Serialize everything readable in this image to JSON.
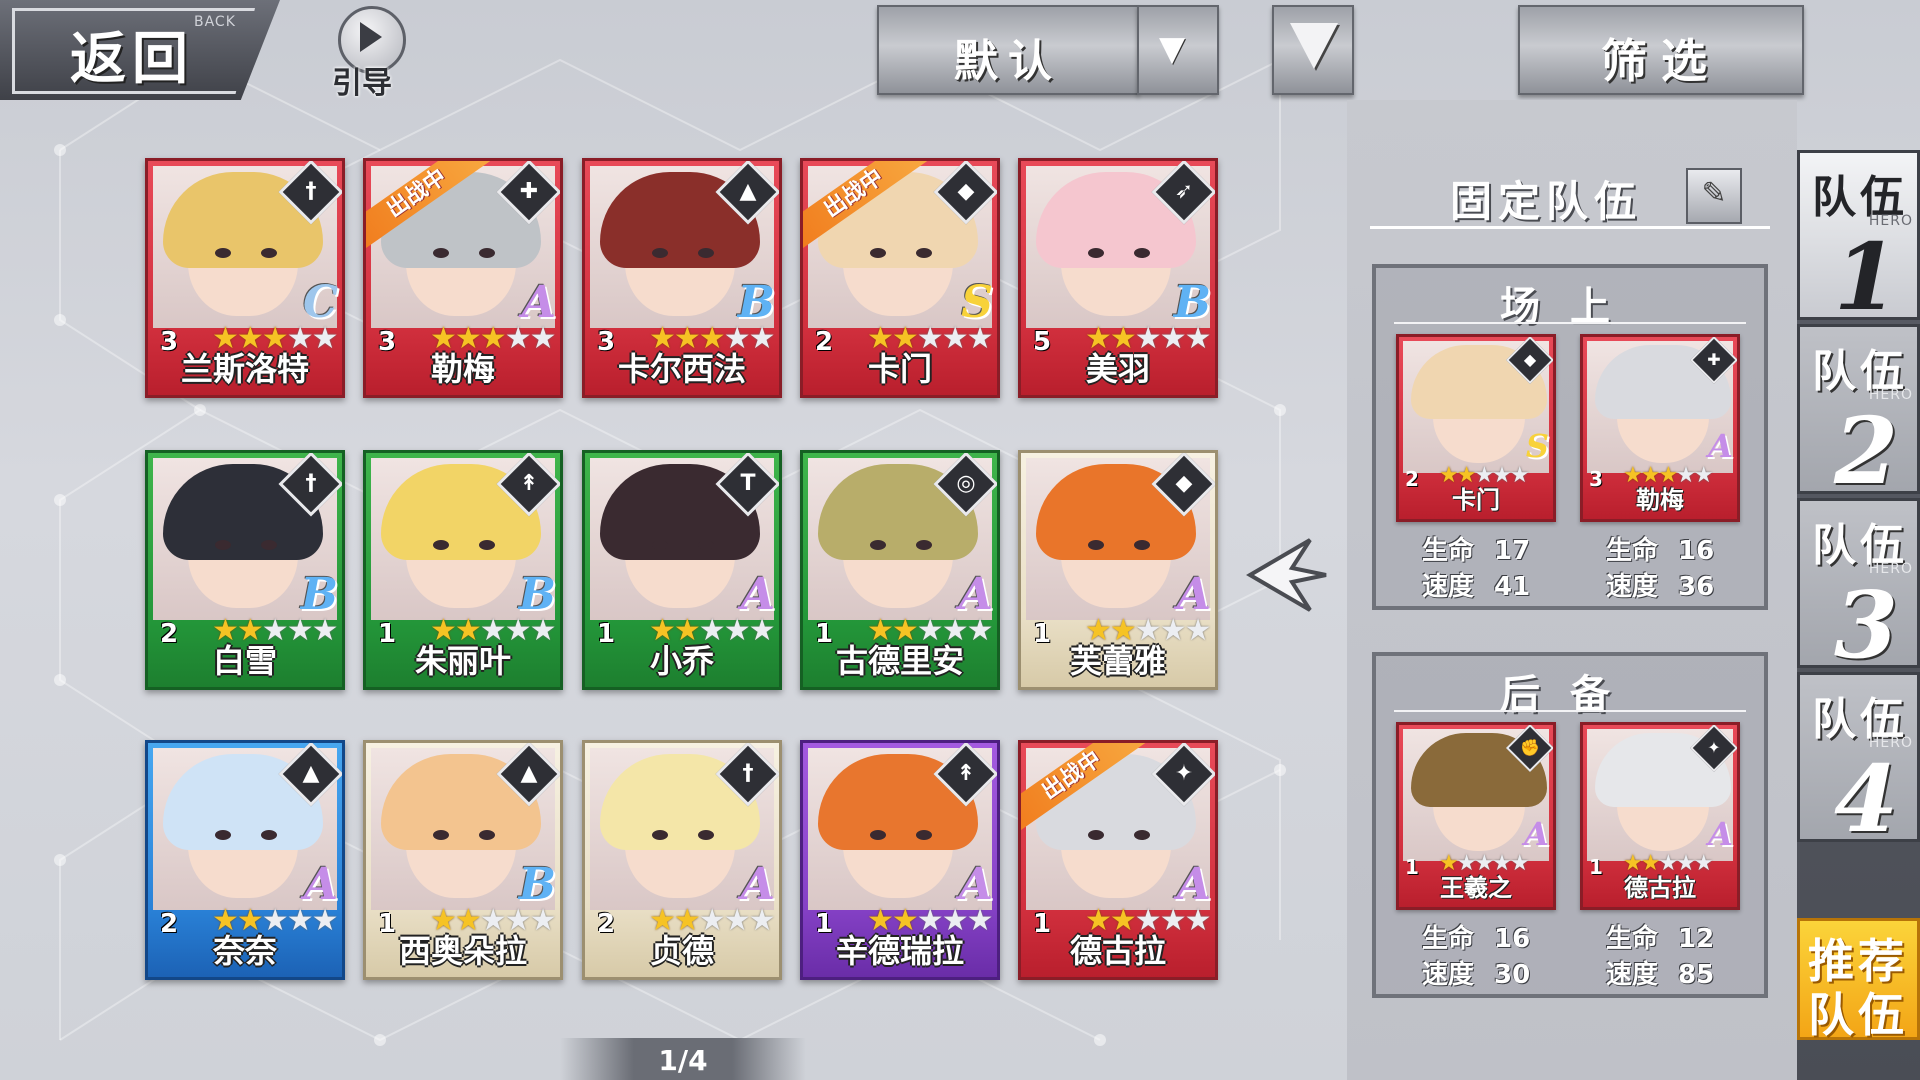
{
  "top_bar": {
    "back_label": "返回",
    "back_sub": "BACK",
    "guide_label": "引导",
    "sort_label": "默认",
    "filter_label": "筛选"
  },
  "heroes": [
    {
      "name": "兰斯洛特",
      "level": "3",
      "stars": 3,
      "rank": "C",
      "color": "red",
      "deployed": false,
      "class_icon": "sword-icon"
    },
    {
      "name": "勒梅",
      "level": "3",
      "stars": 3,
      "rank": "A",
      "color": "red",
      "deployed": true,
      "class_icon": "cross-icon"
    },
    {
      "name": "卡尔西法",
      "level": "3",
      "stars": 3,
      "rank": "B",
      "color": "red",
      "deployed": false,
      "class_icon": "witch-hat-icon"
    },
    {
      "name": "卡门",
      "level": "2",
      "stars": 2,
      "rank": "S",
      "color": "red",
      "deployed": true,
      "class_icon": "mask-icon"
    },
    {
      "name": "美羽",
      "level": "5",
      "stars": 2,
      "rank": "B",
      "color": "red",
      "deployed": false,
      "class_icon": "bow-icon"
    },
    {
      "name": "白雪",
      "level": "2",
      "stars": 2,
      "rank": "B",
      "color": "green",
      "deployed": false,
      "class_icon": "sword-icon"
    },
    {
      "name": "朱丽叶",
      "level": "1",
      "stars": 2,
      "rank": "B",
      "color": "green",
      "deployed": false,
      "class_icon": "spear-icon"
    },
    {
      "name": "小乔",
      "level": "1",
      "stars": 2,
      "rank": "A",
      "color": "green",
      "deployed": false,
      "class_icon": "hammer-icon"
    },
    {
      "name": "古德里安",
      "level": "1",
      "stars": 2,
      "rank": "A",
      "color": "green",
      "deployed": false,
      "class_icon": "target-icon"
    },
    {
      "name": "芙蕾雅",
      "level": "1",
      "stars": 2,
      "rank": "A",
      "color": "cream",
      "deployed": false,
      "class_icon": "mask-icon"
    },
    {
      "name": "奈奈",
      "level": "2",
      "stars": 2,
      "rank": "A",
      "color": "blue",
      "deployed": false,
      "class_icon": "witch-hat-icon"
    },
    {
      "name": "西奥朵拉",
      "level": "1",
      "stars": 2,
      "rank": "B",
      "color": "cream",
      "deployed": false,
      "class_icon": "witch-hat-icon"
    },
    {
      "name": "贞德",
      "level": "2",
      "stars": 2,
      "rank": "A",
      "color": "cream",
      "deployed": false,
      "class_icon": "sword-icon"
    },
    {
      "name": "辛德瑞拉",
      "level": "1",
      "stars": 2,
      "rank": "A",
      "color": "purple",
      "deployed": false,
      "class_icon": "spear-icon"
    },
    {
      "name": "德古拉",
      "level": "1",
      "stars": 2,
      "rank": "A",
      "color": "red",
      "deployed": true,
      "class_icon": "shuriken-icon"
    }
  ],
  "deploy_tag": "出战中",
  "pager": "1/4",
  "panel": {
    "title": "固定队伍",
    "onfield_title": "场上",
    "reserve_title": "后备",
    "stat_hp": "生命",
    "stat_speed": "速度",
    "onfield": [
      {
        "name": "卡门",
        "level": "2",
        "stars": 2,
        "rank": "S",
        "hp": "17",
        "speed": "41",
        "color": "red",
        "class_icon": "mask-icon"
      },
      {
        "name": "勒梅",
        "level": "3",
        "stars": 3,
        "rank": "A",
        "hp": "16",
        "speed": "36",
        "color": "red",
        "class_icon": "cross-icon"
      }
    ],
    "reserve": [
      {
        "name": "王羲之",
        "level": "1",
        "stars": 1,
        "rank": "A",
        "hp": "16",
        "speed": "30",
        "color": "red",
        "class_icon": "fist-icon"
      },
      {
        "name": "德古拉",
        "level": "1",
        "stars": 2,
        "rank": "A",
        "hp": "12",
        "speed": "85",
        "color": "red",
        "class_icon": "shuriken-icon"
      }
    ]
  },
  "teams": [
    {
      "label": "队伍",
      "num": "1",
      "hero": "HERO",
      "active": true
    },
    {
      "label": "队伍",
      "num": "2",
      "hero": "HERO",
      "active": false
    },
    {
      "label": "队伍",
      "num": "3",
      "hero": "HERO",
      "active": false
    },
    {
      "label": "队伍",
      "num": "4",
      "hero": "HERO",
      "active": false
    }
  ],
  "recommend": {
    "line1": "推荐",
    "line2": "队伍"
  },
  "colors": {
    "red": "#d2303e",
    "green": "#24983a",
    "blue": "#2a82d8",
    "cream": "#e9dfc6",
    "purple": "#8541c6",
    "gold": "#f6c324"
  }
}
